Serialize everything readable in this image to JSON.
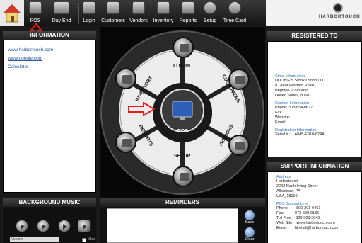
{
  "toolbar": {
    "items": [
      {
        "label": "POS",
        "icon": "pos-monitor-icon"
      },
      {
        "label": "Day End",
        "icon": "day-end-icon"
      },
      {
        "label": "Login",
        "icon": "login-icon"
      },
      {
        "label": "Customers",
        "icon": "customers-icon"
      },
      {
        "label": "Vendors",
        "icon": "vendors-icon"
      },
      {
        "label": "Inventory",
        "icon": "inventory-icon"
      },
      {
        "label": "Reports",
        "icon": "reports-icon"
      },
      {
        "label": "Setup",
        "icon": "setup-icon"
      },
      {
        "label": "Time Card",
        "icon": "time-card-icon"
      }
    ],
    "logo_text": "HARBORTOUCH"
  },
  "information": {
    "title": "INFORMATION",
    "links": [
      "www.harbortouch.com",
      "www.google.com",
      "Calculator"
    ]
  },
  "registered": {
    "title": "REGISTERED TO",
    "store_info_title": "Store Information",
    "store_lines": [
      "DOOBIE'S Smoke Shop LLC",
      "8 Great Western Road",
      "Brighton, Colorado",
      "United States, 80601"
    ],
    "contact_title": "Contact Information",
    "contact_lines": [
      "Phone: 303-654-0627",
      "Fax:",
      "Website:",
      "Email:"
    ],
    "registration_title": "Registration Information",
    "serial": "Serial # :    A845-E910-624A"
  },
  "support": {
    "title": "SUPPORT INFORMATION",
    "address_title": "Address",
    "address_lines": [
      "Harbortouch",
      "2202 North Irving Street",
      "Allentown, PA",
      "USA, 18109"
    ],
    "support_line_title": "POS Support Line",
    "phone": "Phone:       800-201-0461",
    "fax": "Fax:          973-630-9136",
    "toll_free": "Toll Free:   866-563-3045",
    "website": "Web Site:   www.harbortouch.com",
    "email": "Email:       hlretail@harbortouch.com"
  },
  "wheel": {
    "center_label": "POS",
    "segments": [
      "LOG IN",
      "CUSTOMERS",
      "VENDORS",
      "SETUP",
      "REPORTS",
      "INVENTORY"
    ]
  },
  "music": {
    "title": "BACKGROUND MUSIC",
    "volume_label": "Volume",
    "mute_label": "Mute"
  },
  "reminders": {
    "title": "REMINDERS",
    "save_label": "Save",
    "clear_label": "Clear"
  },
  "colors": {
    "arrow": "#e0201c",
    "link": "#2e5aa8",
    "info_title": "#2e6fbf"
  }
}
